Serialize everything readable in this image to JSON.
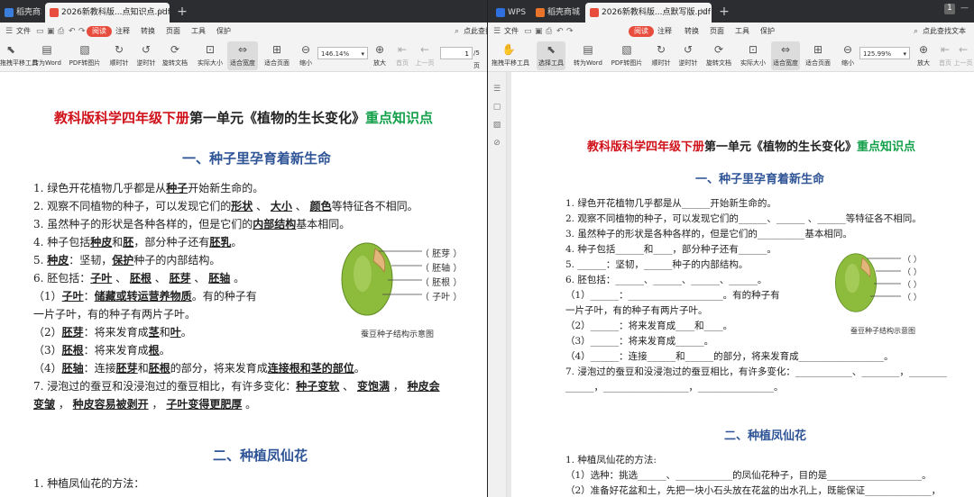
{
  "left_window": {
    "tabs": [
      {
        "label": "稻壳商城",
        "active": false
      },
      {
        "label": "2026新教科版...点知识点.pdf",
        "active": true
      }
    ],
    "menu": {
      "file": "文件",
      "read": "阅读",
      "annotate": "注释",
      "convert": "转换",
      "page": "页面",
      "tools": "工具",
      "protect": "保护",
      "search": "点此查找"
    },
    "toolbar": {
      "hand": "拖拽平移工具",
      "select": "选择工具",
      "to_word": "转为Word",
      "pdf_to_img": "PDF转图片",
      "rotate_cw": "顺时针",
      "rotate_ccw": "逆时针",
      "rotate_doc": "旋转文档",
      "actual_size": "实际大小",
      "fit_width": "适合宽度",
      "fit_page": "适合页面",
      "zoom_out": "缩小",
      "zoom_value": "146.14%",
      "zoom_in": "放大",
      "first_page": "首页",
      "prev_page": "上一页",
      "page_current": "1",
      "page_total": "/5 页"
    },
    "doc": {
      "title_red": "教科版科学四年级下册",
      "title_black": "第一单元《植物的生长变化》",
      "title_green": "重点知识点",
      "section1": "一、种子里孕育着新生命",
      "q1_pre": "1.  绿色开花植物几乎都是从",
      "q1_a": "种子",
      "q1_post": "开始新生命的。",
      "q2_pre": "2.  观察不同植物的种子，可以发现它们的",
      "q2_a1": "形状",
      "q2_a2": "大小",
      "q2_a3": "颜色",
      "q2_post": "等特征各不相同。",
      "q3_pre": "3.  虽然种子的形状是各种各样的，但是它们的",
      "q3_a": "内部结构",
      "q3_post": "基本相同。",
      "q4_pre": "4.  种子包括",
      "q4_a1": "种皮",
      "q4_mid": "和",
      "q4_a2": "胚",
      "q4_mid2": "，部分种子还有",
      "q4_a3": "胚乳",
      "q4_post": "。",
      "q5_pre": "5.  ",
      "q5_a1": "种皮",
      "q5_mid": "：坚韧，",
      "q5_a2": "保护",
      "q5_post": "种子的内部结构。",
      "q6_pre": "6.  胚包括：",
      "q6_a1": "子叶",
      "q6_a2": "胚根",
      "q6_a3": "胚芽",
      "q6_a4": "胚轴",
      "s1_pre": "（1）",
      "s1_a1": "子叶",
      "s1_mid": "：",
      "s1_a2": "储藏或转运营养物质",
      "s1_post": "。有的种子有",
      "s1_cont": "一片子叶，有的种子有两片子叶。",
      "s2_pre": "（2）",
      "s2_a1": "胚芽",
      "s2_mid": "：将来发育成",
      "s2_a2": "茎",
      "s2_mid2": "和",
      "s2_a3": "叶",
      "s3_pre": "（3）",
      "s3_a1": "胚根",
      "s3_mid": "：将来发育成",
      "s3_a2": "根",
      "s4_pre": "（4）",
      "s4_a1": "胚轴",
      "s4_mid": "：连接",
      "s4_a2": "胚芽",
      "s4_mid2": "和",
      "s4_a3": "胚根",
      "s4_mid3": "的部分，将来发育成",
      "s4_a4": "连接根和茎的部位",
      "q7_pre": "7.  浸泡过的蚕豆和没浸泡过的蚕豆相比，有许多变化：",
      "q7_a1": "种子变软",
      "q7_a2": "变饱满",
      "q7_a3": "种皮会",
      "q7_a4": "变皱",
      "q7_a5": "种皮容易被剥开",
      "q7_a6": "子叶变得更肥厚",
      "fig_labels": [
        "（ 胚芽 ）",
        "（ 胚轴 ）",
        "（ 胚根 ）",
        "（ 子叶 ）"
      ],
      "fig_caption": "蚕豆种子结构示意图",
      "section2": "二、种植凤仙花",
      "p1": "1.  种植凤仙花的方法："
    }
  },
  "right_window": {
    "tabs": [
      {
        "label": "WPS",
        "active": false
      },
      {
        "label": "稻壳商城",
        "active": false
      },
      {
        "label": "2026新教科版...点默写版.pdf",
        "active": true
      }
    ],
    "menu": {
      "file": "文件",
      "read": "阅读",
      "annotate": "注释",
      "convert": "转换",
      "page": "页面",
      "tools": "工具",
      "protect": "保护",
      "search": "点此查找文本"
    },
    "toolbar": {
      "hand": "拖拽平移工具",
      "select": "选择工具",
      "to_word": "转为Word",
      "pdf_to_img": "PDF转图片",
      "rotate_cw": "顺时针",
      "rotate_ccw": "逆时针",
      "rotate_doc": "旋转文档",
      "actual_size": "实际大小",
      "fit_width": "适合宽度",
      "fit_page": "适合页面",
      "zoom_out": "缩小",
      "zoom_value": "125.99%",
      "zoom_in": "放大",
      "first_page": "首页",
      "prev_page": "上一页"
    },
    "doc": {
      "title_red": "教科版科学四年级下册",
      "title_black": "第一单元《植物的生长变化》",
      "title_green": "重点知识点",
      "section1": "一、种子里孕育着新生命",
      "l1": "1.  绿色开花植物几乎都是从______开始新生命的。",
      "l2": "2.  观察不同植物的种子，可以发现它们的______、______ 、______等特征各不相同。",
      "l3": "3.  虽然种子的形状是各种各样的，但是它们的__________基本相同。",
      "l4": "4.  种子包括______和____，部分种子还有______。",
      "l5": "5.  ______：坚韧，______种子的内部结构。",
      "l6": "6.  胚包括：______、______、______、______。",
      "l7": "（1）______：____________________。有的种子有",
      "l8": "一片子叶，有的种子有两片子叶。",
      "l9": "（2）______：将来发育成____和____。",
      "l10": "（3）______：将来发育成______。",
      "l11": "（4）______：连接______和______的部分，将来发育成__________________。",
      "l12": "7.  浸泡过的蚕豆和没浸泡过的蚕豆相比，有许多变化：____________、________，________",
      "l13": "______，__________________，________________。",
      "fig_labels": [
        "（          ）",
        "（          ）",
        "（          ）",
        "（          ）"
      ],
      "fig_caption": "蚕豆种子结构示意图",
      "section2": "二、种植凤仙花",
      "p1": "1.  种植凤仙花的方法:",
      "p2": "（1）选种：挑选______、____________的凤仙花种子，目的是____________________。",
      "p3": "（2）准备好花盆和土，先把一块小石头放在花盆的出水孔上，既能保证______________，"
    }
  },
  "colors": {
    "title_red": "#d0121b",
    "title_green": "#14a04a",
    "section_blue": "#2f5597",
    "read_pill": "#e84c3d",
    "seed_green": "#8dbb3c"
  }
}
